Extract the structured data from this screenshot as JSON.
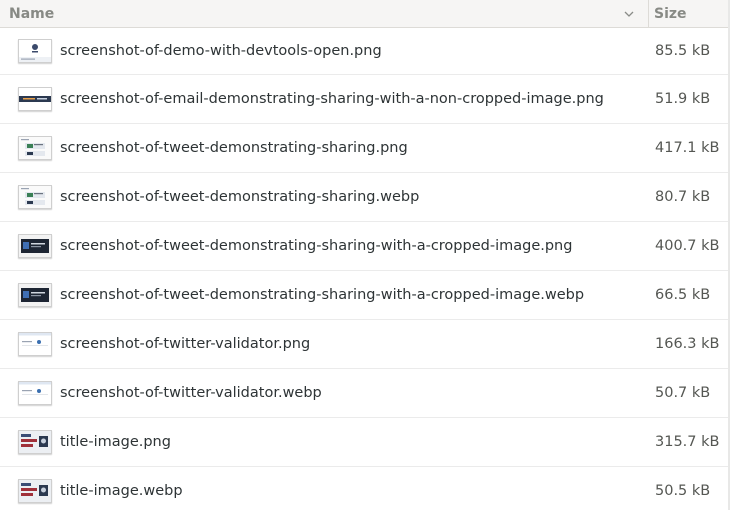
{
  "header": {
    "name_label": "Name",
    "size_label": "Size"
  },
  "files": [
    {
      "name": "screenshot-of-demo-with-devtools-open.png",
      "size": "85.5 kB",
      "thumb": "devtools"
    },
    {
      "name": "screenshot-of-email-demonstrating-sharing-with-a-non-cropped-image.png",
      "size": "51.9 kB",
      "thumb": "banner"
    },
    {
      "name": "screenshot-of-tweet-demonstrating-sharing.png",
      "size": "417.1 kB",
      "thumb": "tweet"
    },
    {
      "name": "screenshot-of-tweet-demonstrating-sharing.webp",
      "size": "80.7 kB",
      "thumb": "tweet"
    },
    {
      "name": "screenshot-of-tweet-demonstrating-sharing-with-a-cropped-image.png",
      "size": "400.7 kB",
      "thumb": "dark"
    },
    {
      "name": "screenshot-of-tweet-demonstrating-sharing-with-a-cropped-image.webp",
      "size": "66.5 kB",
      "thumb": "dark"
    },
    {
      "name": "screenshot-of-twitter-validator.png",
      "size": "166.3 kB",
      "thumb": "validator"
    },
    {
      "name": "screenshot-of-twitter-validator.webp",
      "size": "50.7 kB",
      "thumb": "validator"
    },
    {
      "name": "title-image.png",
      "size": "315.7 kB",
      "thumb": "title"
    },
    {
      "name": "title-image.webp",
      "size": "50.5 kB",
      "thumb": "title"
    }
  ]
}
